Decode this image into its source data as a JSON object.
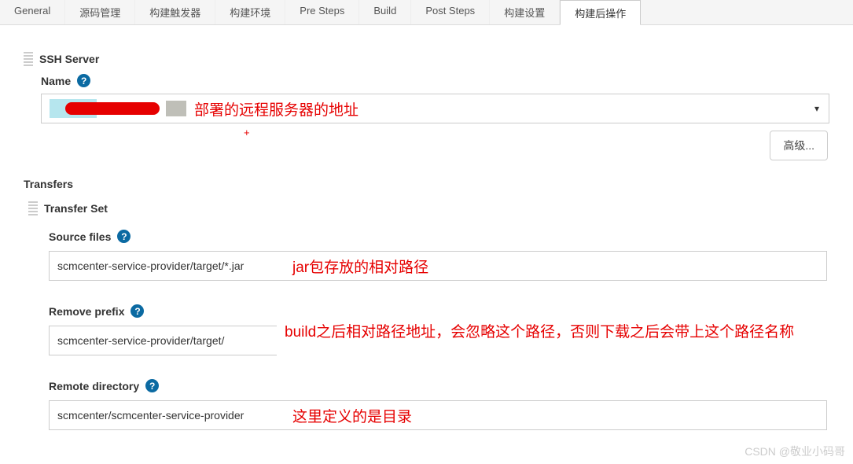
{
  "tabs": {
    "general": "General",
    "scm": "源码管理",
    "triggers": "构建触发器",
    "env": "构建环境",
    "presteps": "Pre Steps",
    "build": "Build",
    "poststeps": "Post Steps",
    "settings": "构建设置",
    "postbuild": "构建后操作"
  },
  "ssh": {
    "title": "SSH Server",
    "name_label": "Name",
    "server_annotation": "部署的远程服务器的地址",
    "advanced_btn": "高级..."
  },
  "transfers": {
    "title": "Transfers",
    "set_title": "Transfer Set",
    "source_files": {
      "label": "Source files",
      "value": "scmcenter-service-provider/target/*.jar",
      "annotation": "jar包存放的相对路径"
    },
    "remove_prefix": {
      "label": "Remove prefix",
      "value": "scmcenter-service-provider/target/",
      "annotation": "build之后相对路径地址，会忽略这个路径，否则下载之后会带上这个路径名称"
    },
    "remote_directory": {
      "label": "Remote directory",
      "value": "scmcenter/scmcenter-service-provider",
      "annotation": "这里定义的是目录"
    }
  },
  "watermark": "CSDN @敬业小码哥"
}
